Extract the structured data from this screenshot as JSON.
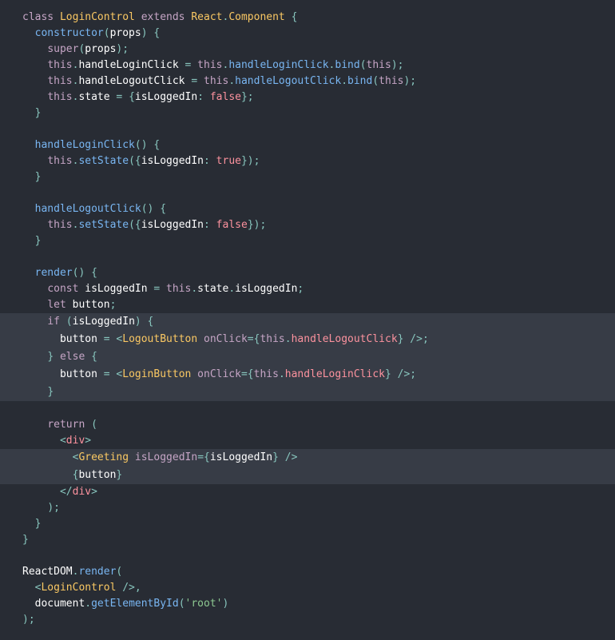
{
  "code": {
    "lines": [
      {
        "hl": false,
        "tokens": [
          [
            "kw",
            "class "
          ],
          [
            "cls",
            "LoginControl "
          ],
          [
            "kw",
            "extends "
          ],
          [
            "cls",
            "React"
          ],
          [
            "punc",
            "."
          ],
          [
            "cls",
            "Component "
          ],
          [
            "punc",
            "{"
          ]
        ]
      },
      {
        "hl": false,
        "tokens": [
          [
            "plain",
            "  "
          ],
          [
            "fn",
            "constructor"
          ],
          [
            "punc",
            "("
          ],
          [
            "plain",
            "props"
          ],
          [
            "punc",
            ") {"
          ]
        ]
      },
      {
        "hl": false,
        "tokens": [
          [
            "plain",
            "    "
          ],
          [
            "kw",
            "super"
          ],
          [
            "punc",
            "("
          ],
          [
            "plain",
            "props"
          ],
          [
            "punc",
            ");"
          ]
        ]
      },
      {
        "hl": false,
        "tokens": [
          [
            "plain",
            "    "
          ],
          [
            "this",
            "this"
          ],
          [
            "punc",
            "."
          ],
          [
            "plain",
            "handleLoginClick "
          ],
          [
            "punc",
            "= "
          ],
          [
            "this",
            "this"
          ],
          [
            "punc",
            "."
          ],
          [
            "fn",
            "handleLoginClick"
          ],
          [
            "punc",
            "."
          ],
          [
            "fn",
            "bind"
          ],
          [
            "punc",
            "("
          ],
          [
            "this",
            "this"
          ],
          [
            "punc",
            ");"
          ]
        ]
      },
      {
        "hl": false,
        "tokens": [
          [
            "plain",
            "    "
          ],
          [
            "this",
            "this"
          ],
          [
            "punc",
            "."
          ],
          [
            "plain",
            "handleLogoutClick "
          ],
          [
            "punc",
            "= "
          ],
          [
            "this",
            "this"
          ],
          [
            "punc",
            "."
          ],
          [
            "fn",
            "handleLogoutClick"
          ],
          [
            "punc",
            "."
          ],
          [
            "fn",
            "bind"
          ],
          [
            "punc",
            "("
          ],
          [
            "this",
            "this"
          ],
          [
            "punc",
            ");"
          ]
        ]
      },
      {
        "hl": false,
        "tokens": [
          [
            "plain",
            "    "
          ],
          [
            "this",
            "this"
          ],
          [
            "punc",
            "."
          ],
          [
            "plain",
            "state "
          ],
          [
            "punc",
            "= {"
          ],
          [
            "plain",
            "isLoggedIn"
          ],
          [
            "punc",
            ": "
          ],
          [
            "num",
            "false"
          ],
          [
            "punc",
            "};"
          ]
        ]
      },
      {
        "hl": false,
        "tokens": [
          [
            "plain",
            "  "
          ],
          [
            "punc",
            "}"
          ]
        ]
      },
      {
        "hl": false,
        "tokens": [
          [
            "plain",
            " "
          ]
        ]
      },
      {
        "hl": false,
        "tokens": [
          [
            "plain",
            "  "
          ],
          [
            "fn",
            "handleLoginClick"
          ],
          [
            "punc",
            "() {"
          ]
        ]
      },
      {
        "hl": false,
        "tokens": [
          [
            "plain",
            "    "
          ],
          [
            "this",
            "this"
          ],
          [
            "punc",
            "."
          ],
          [
            "fn",
            "setState"
          ],
          [
            "punc",
            "({"
          ],
          [
            "plain",
            "isLoggedIn"
          ],
          [
            "punc",
            ": "
          ],
          [
            "num",
            "true"
          ],
          [
            "punc",
            "});"
          ]
        ]
      },
      {
        "hl": false,
        "tokens": [
          [
            "plain",
            "  "
          ],
          [
            "punc",
            "}"
          ]
        ]
      },
      {
        "hl": false,
        "tokens": [
          [
            "plain",
            " "
          ]
        ]
      },
      {
        "hl": false,
        "tokens": [
          [
            "plain",
            "  "
          ],
          [
            "fn",
            "handleLogoutClick"
          ],
          [
            "punc",
            "() {"
          ]
        ]
      },
      {
        "hl": false,
        "tokens": [
          [
            "plain",
            "    "
          ],
          [
            "this",
            "this"
          ],
          [
            "punc",
            "."
          ],
          [
            "fn",
            "setState"
          ],
          [
            "punc",
            "({"
          ],
          [
            "plain",
            "isLoggedIn"
          ],
          [
            "punc",
            ": "
          ],
          [
            "num",
            "false"
          ],
          [
            "punc",
            "});"
          ]
        ]
      },
      {
        "hl": false,
        "tokens": [
          [
            "plain",
            "  "
          ],
          [
            "punc",
            "}"
          ]
        ]
      },
      {
        "hl": false,
        "tokens": [
          [
            "plain",
            " "
          ]
        ]
      },
      {
        "hl": false,
        "tokens": [
          [
            "plain",
            "  "
          ],
          [
            "fn",
            "render"
          ],
          [
            "punc",
            "() {"
          ]
        ]
      },
      {
        "hl": false,
        "tokens": [
          [
            "plain",
            "    "
          ],
          [
            "kw",
            "const "
          ],
          [
            "plain",
            "isLoggedIn "
          ],
          [
            "punc",
            "= "
          ],
          [
            "this",
            "this"
          ],
          [
            "punc",
            "."
          ],
          [
            "plain",
            "state"
          ],
          [
            "punc",
            "."
          ],
          [
            "plain",
            "isLoggedIn"
          ],
          [
            "punc",
            ";"
          ]
        ]
      },
      {
        "hl": false,
        "tokens": [
          [
            "plain",
            "    "
          ],
          [
            "kw",
            "let "
          ],
          [
            "plain",
            "button"
          ],
          [
            "punc",
            ";"
          ]
        ]
      },
      {
        "hl": true,
        "tokens": [
          [
            "plain",
            "    "
          ],
          [
            "kw",
            "if "
          ],
          [
            "punc",
            "("
          ],
          [
            "plain",
            "isLoggedIn"
          ],
          [
            "punc",
            ") {"
          ]
        ]
      },
      {
        "hl": true,
        "tokens": [
          [
            "plain",
            "      "
          ],
          [
            "plain",
            "button "
          ],
          [
            "punc",
            "= <"
          ],
          [
            "comp",
            "LogoutButton "
          ],
          [
            "attr",
            "onClick"
          ],
          [
            "punc",
            "={"
          ],
          [
            "this",
            "this"
          ],
          [
            "punc",
            "."
          ],
          [
            "tag",
            "handleLogoutClick"
          ],
          [
            "punc",
            "} />;"
          ]
        ]
      },
      {
        "hl": true,
        "tokens": [
          [
            "plain",
            "    "
          ],
          [
            "punc",
            "} "
          ],
          [
            "kw",
            "else "
          ],
          [
            "punc",
            "{"
          ]
        ]
      },
      {
        "hl": true,
        "tokens": [
          [
            "plain",
            "      "
          ],
          [
            "plain",
            "button "
          ],
          [
            "punc",
            "= <"
          ],
          [
            "comp",
            "LoginButton "
          ],
          [
            "attr",
            "onClick"
          ],
          [
            "punc",
            "={"
          ],
          [
            "this",
            "this"
          ],
          [
            "punc",
            "."
          ],
          [
            "tag",
            "handleLoginClick"
          ],
          [
            "punc",
            "} />;"
          ]
        ]
      },
      {
        "hl": true,
        "tokens": [
          [
            "plain",
            "    "
          ],
          [
            "punc",
            "}"
          ]
        ]
      },
      {
        "hl": false,
        "tokens": [
          [
            "plain",
            " "
          ]
        ]
      },
      {
        "hl": false,
        "tokens": [
          [
            "plain",
            "    "
          ],
          [
            "kw",
            "return "
          ],
          [
            "punc",
            "("
          ]
        ]
      },
      {
        "hl": false,
        "tokens": [
          [
            "plain",
            "      "
          ],
          [
            "punc",
            "<"
          ],
          [
            "tag",
            "div"
          ],
          [
            "punc",
            ">"
          ]
        ]
      },
      {
        "hl": true,
        "tokens": [
          [
            "plain",
            "        "
          ],
          [
            "punc",
            "<"
          ],
          [
            "comp",
            "Greeting "
          ],
          [
            "attr",
            "isLoggedIn"
          ],
          [
            "punc",
            "={"
          ],
          [
            "plain",
            "isLoggedIn"
          ],
          [
            "punc",
            "} />"
          ]
        ]
      },
      {
        "hl": true,
        "tokens": [
          [
            "plain",
            "        "
          ],
          [
            "punc",
            "{"
          ],
          [
            "plain",
            "button"
          ],
          [
            "punc",
            "}"
          ]
        ]
      },
      {
        "hl": false,
        "tokens": [
          [
            "plain",
            "      "
          ],
          [
            "punc",
            "</"
          ],
          [
            "tag",
            "div"
          ],
          [
            "punc",
            ">"
          ]
        ]
      },
      {
        "hl": false,
        "tokens": [
          [
            "plain",
            "    "
          ],
          [
            "punc",
            ");"
          ]
        ]
      },
      {
        "hl": false,
        "tokens": [
          [
            "plain",
            "  "
          ],
          [
            "punc",
            "}"
          ]
        ]
      },
      {
        "hl": false,
        "tokens": [
          [
            "punc",
            "}"
          ]
        ]
      },
      {
        "hl": false,
        "tokens": [
          [
            "plain",
            " "
          ]
        ]
      },
      {
        "hl": false,
        "tokens": [
          [
            "plain",
            "ReactDOM"
          ],
          [
            "punc",
            "."
          ],
          [
            "fn",
            "render"
          ],
          [
            "punc",
            "("
          ]
        ]
      },
      {
        "hl": false,
        "tokens": [
          [
            "plain",
            "  "
          ],
          [
            "punc",
            "<"
          ],
          [
            "comp",
            "LoginControl "
          ],
          [
            "punc",
            "/>,"
          ]
        ]
      },
      {
        "hl": false,
        "tokens": [
          [
            "plain",
            "  "
          ],
          [
            "plain",
            "document"
          ],
          [
            "punc",
            "."
          ],
          [
            "fn",
            "getElementById"
          ],
          [
            "punc",
            "("
          ],
          [
            "str",
            "'root'"
          ],
          [
            "punc",
            ")"
          ]
        ]
      },
      {
        "hl": false,
        "tokens": [
          [
            "punc",
            ");"
          ]
        ]
      }
    ]
  }
}
